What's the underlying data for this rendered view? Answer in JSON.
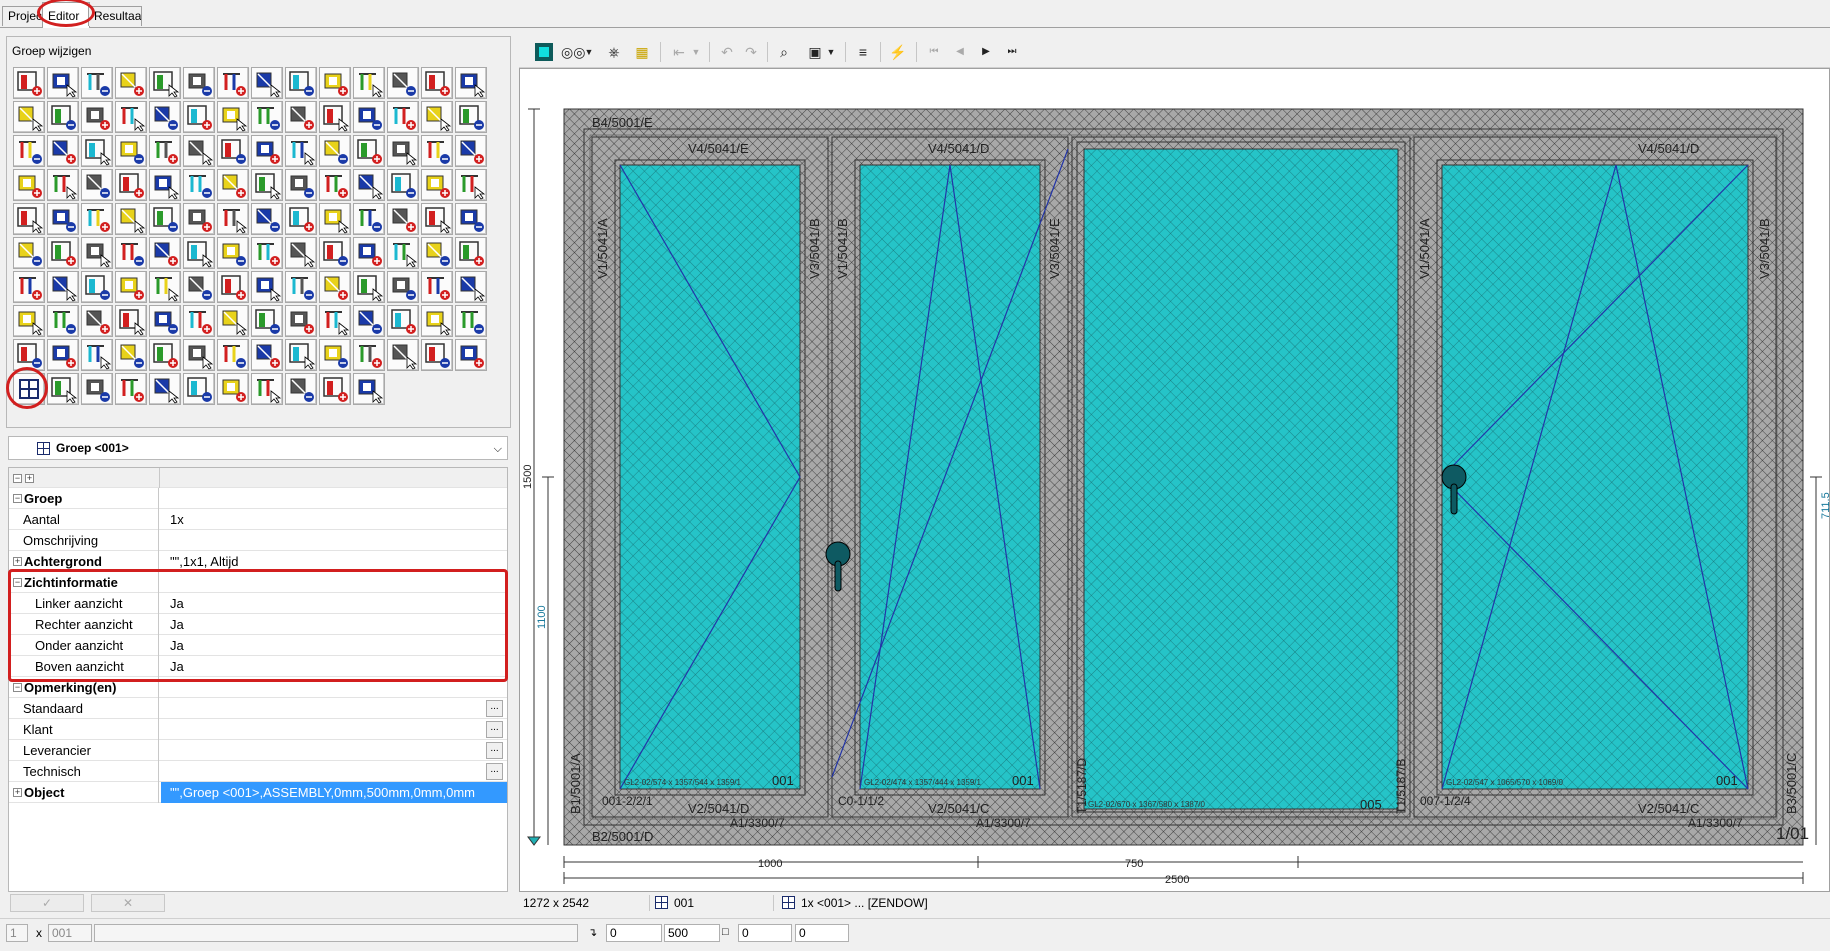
{
  "tabs": [
    {
      "label": "Project"
    },
    {
      "label": "Editor"
    },
    {
      "label": "Resultaat"
    }
  ],
  "panel": {
    "title": "Groep wijzigen"
  },
  "combo": {
    "label": "Groep <001>"
  },
  "properties": [
    {
      "name": "Groep",
      "value": "",
      "type": "cat",
      "bold": true
    },
    {
      "name": "Aantal",
      "value": "1x"
    },
    {
      "name": "Omschrijving",
      "value": ""
    },
    {
      "name": "Achtergrond",
      "value": "\"\",1x1, Altijd",
      "type": "cat",
      "bold": true,
      "collapsed": true
    },
    {
      "name": "Zichtinformatie",
      "value": "",
      "type": "cat",
      "bold": true
    },
    {
      "name": "Linker aanzicht",
      "value": "Ja",
      "indent": true
    },
    {
      "name": "Rechter aanzicht",
      "value": "Ja",
      "indent": true
    },
    {
      "name": "Onder aanzicht",
      "value": "Ja",
      "indent": true
    },
    {
      "name": "Boven aanzicht",
      "value": "Ja",
      "indent": true
    },
    {
      "name": "Opmerking(en)",
      "value": "",
      "type": "cat",
      "bold": true
    },
    {
      "name": "Standaard",
      "value": "",
      "ellipsis": true
    },
    {
      "name": "Klant",
      "value": "",
      "ellipsis": true
    },
    {
      "name": "Leverancier",
      "value": "",
      "ellipsis": true
    },
    {
      "name": "Technisch",
      "value": "",
      "ellipsis": true
    },
    {
      "name": "Object",
      "value": "\"\",Groep <001>,ASSEMBLY,0mm,500mm,0mm,0mm",
      "type": "cat",
      "bold": true,
      "collapsed": true,
      "selected": true
    }
  ],
  "left_buttons": {
    "ok": "✓",
    "cancel": "✕"
  },
  "drawing": {
    "frame_labels": {
      "top": "B4/5001/E",
      "bottom": "B2/5001/D",
      "left": "B1/5001/A",
      "right": "B3/5001/C",
      "corner": "1/01"
    },
    "sash1": {
      "top": "V4/5041/E",
      "bottom": "V2/5041/D",
      "left": "V1/5041/A",
      "right": "V3/5041/B",
      "glass": "001",
      "glass_info": "GL2-02/574 x 1357/544 x 1359/1",
      "bottom_left": "001-2/2/1",
      "bottom_right": "A1/3300/7"
    },
    "sash2": {
      "top": "V4/5041/D",
      "bottom": "V2/5041/C",
      "left": "V1/5041/B",
      "right": "V3/5041/E",
      "glass": "001",
      "glass_info": "GL2-02/474 x 1357/444 x 1359/1",
      "bottom_left": "C0-1/1/2",
      "bottom_right": "A1/3300/7"
    },
    "fixed": {
      "glass": "005",
      "glass_info": "GL2-02/670 x 1367/580 x 1387/0",
      "left": "T1/5187/D",
      "right": "T1/5187/B"
    },
    "sash3": {
      "top": "V4/5041/D",
      "bottom": "V2/5041/C",
      "left": "V1/5041/A",
      "right": "V3/5041/B",
      "glass": "001",
      "glass_info": "GL2-02/547 x 1065/570 x 1069/0",
      "bottom_left": "007-1/2/4",
      "bottom_right": "A1/3300/7"
    },
    "dims": {
      "height": "1500",
      "handle_height": "1100",
      "right_height": "711.5",
      "width_left": "1000",
      "width_mid": "750",
      "width_total": "2500"
    }
  },
  "status": {
    "size": "1272 x 2542",
    "group": "001",
    "desc": "1x <001> ... [ZENDOW]"
  },
  "bottom": {
    "qty": "1",
    "x": "x",
    "code": "001",
    "f1": "0",
    "f2": "500",
    "f3": "0",
    "f4": "0"
  },
  "colors": {
    "glass": "#25c4c8",
    "frame": "#a6a6a6",
    "accent": "#d21f1f",
    "selection": "#3399ff"
  }
}
